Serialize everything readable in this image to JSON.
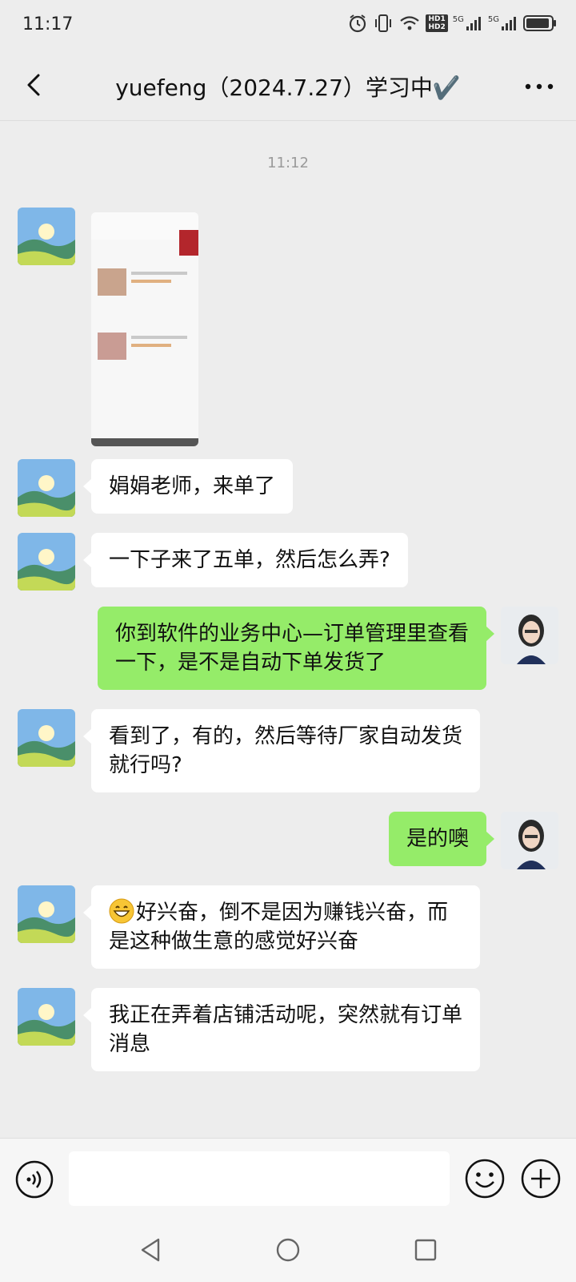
{
  "status_bar": {
    "time": "11:17",
    "icons": [
      "alarm-icon",
      "vibrate-icon",
      "wifi-icon",
      "hd-icon",
      "signal-5g-icon",
      "signal-5g-icon",
      "battery-icon"
    ],
    "network_labels": [
      "HD1",
      "HD2",
      "5G",
      "5G"
    ]
  },
  "header": {
    "title": "yuefeng（2024.7.27）学习中✔️",
    "back_icon": "chevron-left-icon",
    "more_icon": "more-dots-icon"
  },
  "chat": {
    "timestamp": "11:12",
    "messages": [
      {
        "side": "left",
        "type": "image",
        "content": "screenshot-thumbnail"
      },
      {
        "side": "left",
        "type": "text",
        "text": "娟娟老师，来单了"
      },
      {
        "side": "left",
        "type": "text",
        "text": "一下子来了五单，然后怎么弄?"
      },
      {
        "side": "right",
        "type": "text",
        "text": "你到软件的业务中心—订单管理里查看一下，是不是自动下单发货了"
      },
      {
        "side": "left",
        "type": "text",
        "text": "看到了，有的，然后等待厂家自动发货就行吗?"
      },
      {
        "side": "right",
        "type": "text",
        "text": "是的噢"
      },
      {
        "side": "left",
        "type": "text",
        "emoji": "grin-emoji",
        "text": "好兴奋，倒不是因为赚钱兴奋，而是这种做生意的感觉好兴奋"
      },
      {
        "side": "left",
        "type": "text",
        "text": "我正在弄着店铺活动呢，突然就有订单消息"
      }
    ]
  },
  "input_bar": {
    "voice_icon": "voice-icon",
    "input_value": "",
    "emoji_icon": "smiley-icon",
    "plus_icon": "plus-icon"
  },
  "nav_bar": {
    "icons": [
      "nav-back-icon",
      "nav-home-icon",
      "nav-recent-icon"
    ]
  },
  "colors": {
    "background": "#ededed",
    "bubble_self": "#95ec69",
    "bubble_other": "#ffffff",
    "timestamp": "#9a9a9a"
  }
}
